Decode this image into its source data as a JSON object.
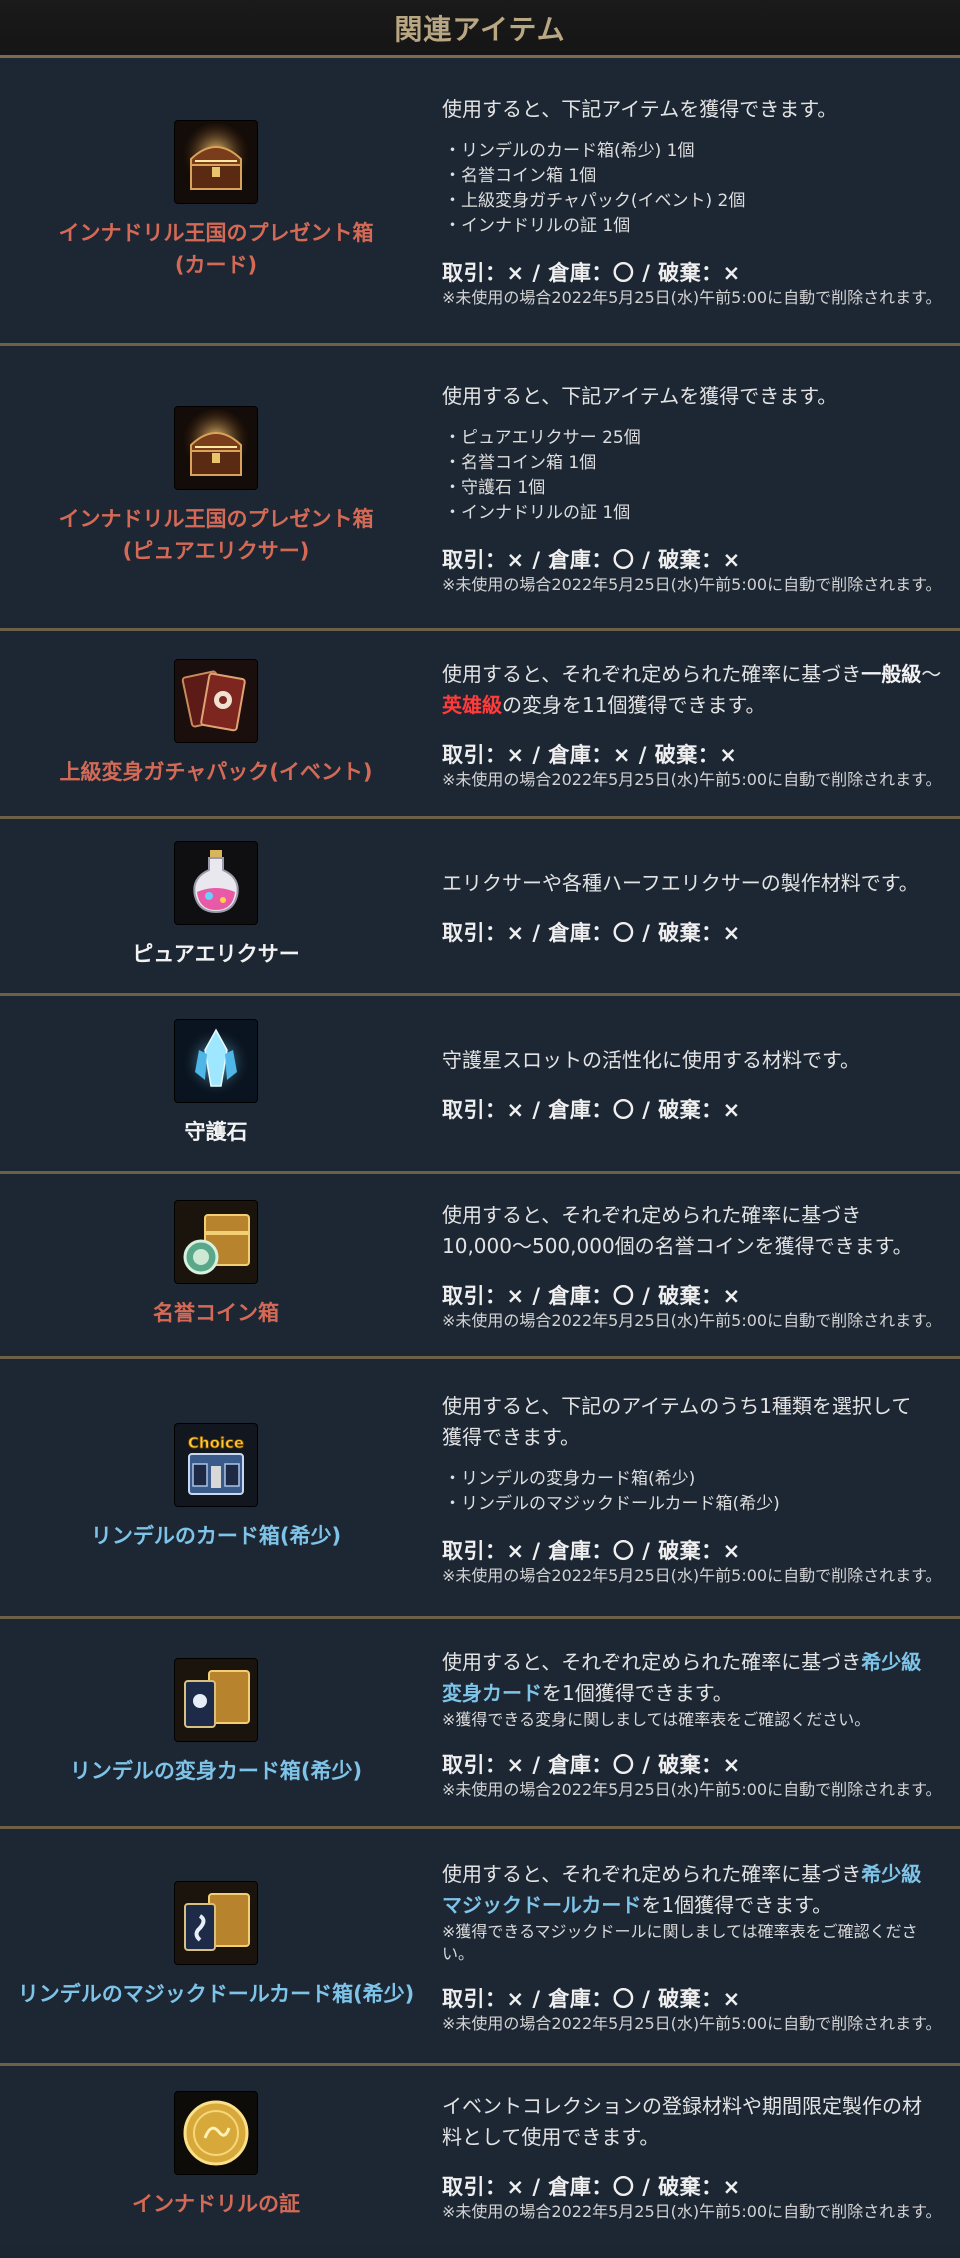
{
  "header": {
    "title": "関連アイテム"
  },
  "trade_default": "取引：× / 倉庫：〇 / 破棄：×",
  "trade_no_storage": "取引：× / 倉庫：× / 破棄：×",
  "expire_note": "※未使用の場合2022年5月25日(水)午前5:00に自動で削除されます。",
  "items": [
    {
      "name_lines": [
        "インナドリル王国のプレゼント箱",
        "(カード)"
      ],
      "icon": "treasure-chest-icon",
      "desc": "使用すると、下記アイテムを獲得できます。",
      "list": [
        "・リンデルのカード箱(希少) 1個",
        "・名誉コイン箱 1個",
        "・上級変身ガチャパック(イベント) 2個",
        "・インナドリルの証 1個"
      ],
      "trade": "取引：× / 倉庫：〇 / 破棄：×",
      "expire": "※未使用の場合2022年5月25日(水)午前5:00に自動で削除されます。"
    },
    {
      "name_lines": [
        "インナドリル王国のプレゼント箱",
        "(ピュアエリクサー)"
      ],
      "icon": "treasure-chest-icon",
      "desc": "使用すると、下記アイテムを獲得できます。",
      "list": [
        "・ピュアエリクサー 25個",
        "・名誉コイン箱 1個",
        "・守護石 1個",
        "・インナドリルの証 1個"
      ],
      "trade": "取引：× / 倉庫：〇 / 破棄：×",
      "expire": "※未使用の場合2022年5月25日(水)午前5:00に自動で削除されます。"
    },
    {
      "name_lines": [
        "上級変身ガチャパック(イベント)"
      ],
      "icon": "card-pack-icon",
      "desc_parts": [
        "使用すると、それぞれ定められた確率に基づき",
        "一般級",
        "～",
        "英雄級",
        "の変身を11個獲得できます。"
      ],
      "trade": "取引：× / 倉庫：× / 破棄：×",
      "expire": "※未使用の場合2022年5月25日(水)午前5:00に自動で削除されます。"
    },
    {
      "name_lines": [
        "ピュアエリクサー"
      ],
      "icon": "potion-flask-icon",
      "desc": "エリクサーや各種ハーフエリクサーの製作材料です。",
      "trade": "取引：× / 倉庫：〇 / 破棄：×"
    },
    {
      "name_lines": [
        "守護石"
      ],
      "icon": "blue-crystal-icon",
      "desc": "守護星スロットの活性化に使用する材料です。",
      "trade": "取引：× / 倉庫：〇 / 破棄：×"
    },
    {
      "name_lines": [
        "名誉コイン箱"
      ],
      "icon": "coin-chest-icon",
      "desc_lines": [
        "使用すると、それぞれ定められた確率に基づき",
        "10,000～500,000個の名誉コインを獲得できます。"
      ],
      "trade": "取引：× / 倉庫：〇 / 破棄：×",
      "expire": "※未使用の場合2022年5月25日(水)午前5:00に自動で削除されます。"
    },
    {
      "name_lines": [
        "リンデルのカード箱(希少)"
      ],
      "icon": "choice-box-icon",
      "icon_text": "Choice",
      "desc_lines": [
        "使用すると、下記のアイテムのうち1種類を選択して",
        "獲得できます。"
      ],
      "list": [
        "・リンデルの変身カード箱(希少)",
        "・リンデルのマジックドールカード箱(希少)"
      ],
      "trade": "取引：× / 倉庫：〇 / 破棄：×",
      "expire": "※未使用の場合2022年5月25日(水)午前5:00に自動で削除されます。"
    },
    {
      "name_lines": [
        "リンデルの変身カード箱(希少)"
      ],
      "icon": "card-chest-icon",
      "desc_parts": [
        "使用すると、それぞれ定められた確率に基づき",
        "希少級",
        "変身カード",
        "を1個獲得できます。"
      ],
      "note": "※獲得できる変身に関しましては確率表をご確認ください。",
      "trade": "取引：× / 倉庫：〇 / 破棄：×",
      "expire": "※未使用の場合2022年5月25日(水)午前5:00に自動で削除されます。"
    },
    {
      "name_lines": [
        "リンデルのマジックドールカード箱(希少)"
      ],
      "icon": "doll-card-chest-icon",
      "desc_parts": [
        "使用すると、それぞれ定められた確率に基づき",
        "希少級",
        "マジックドールカード",
        "を1個獲得できます。"
      ],
      "note": "※獲得できるマジックドールに関しましては確率表をご確認ください。",
      "trade": "取引：× / 倉庫：〇 / 破棄：×",
      "expire": "※未使用の場合2022年5月25日(水)午前5:00に自動で削除されます。"
    },
    {
      "name_lines": [
        "インナドリルの証"
      ],
      "icon": "gold-coin-icon",
      "desc_lines": [
        "イベントコレクションの登録材料や期間限定製作の材",
        "料として使用できます。"
      ],
      "trade": "取引：× / 倉庫：〇 / 破棄：×",
      "expire": "※未使用の場合2022年5月25日(水)午前5:00に自動で削除されます。"
    }
  ],
  "colors": {
    "background": "#1c2632",
    "divider": "#6e5f47",
    "title": "#b9a783",
    "name_red": "#d46a56",
    "name_blue": "#7ec3e8",
    "highlight_red": "#ff3b3b"
  }
}
